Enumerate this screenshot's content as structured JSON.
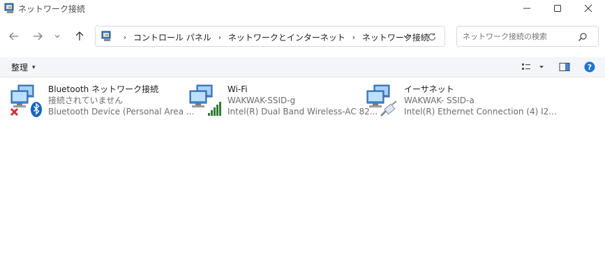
{
  "window": {
    "title": "ネットワーク接続",
    "minimize_label": "—",
    "maximize_label": "☐",
    "close_label": "✕"
  },
  "nav": {
    "back_label": "←",
    "forward_label": "→",
    "recent_label": "⌄",
    "up_label": "↑"
  },
  "address": {
    "breadcrumbs": [
      "コントロール パネル",
      "ネットワークとインターネット",
      "ネットワーク接続"
    ],
    "separator": "›"
  },
  "search": {
    "placeholder": "ネットワーク接続の検索"
  },
  "toolbar": {
    "organize_label": "整理",
    "organize_caret": "▾"
  },
  "connections": [
    {
      "name": "Bluetooth ネットワーク接続",
      "status": "接続されていません",
      "device": "Bluetooth Device (Personal Area ...",
      "icon": "bluetooth-network-icon"
    },
    {
      "name": "Wi-Fi",
      "status": "WAKWAK-SSID-g",
      "device": "Intel(R) Dual Band Wireless-AC 82...",
      "icon": "wifi-network-icon"
    },
    {
      "name": "イーサネット",
      "status": "WAKWAK- SSID-a",
      "device": "Intel(R) Ethernet Connection (4) I2...",
      "icon": "ethernet-network-icon"
    }
  ],
  "colors": {
    "accent": "#1a73e8",
    "disconnected_red": "#d32f2f",
    "bluetooth_blue": "#1565c0",
    "wifi_green": "#2e7d32",
    "help_blue": "#1976d2"
  }
}
